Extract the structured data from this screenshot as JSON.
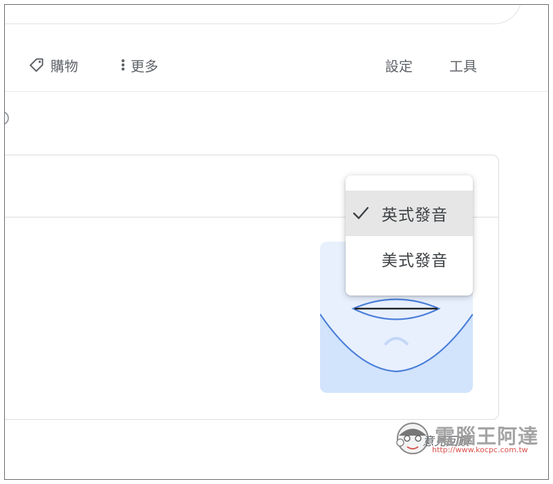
{
  "toolbar": {
    "shopping_label": "購物",
    "more_label": "更多",
    "settings_label": "設定",
    "tools_label": "工具"
  },
  "pronunciation_menu": {
    "items": [
      {
        "label": "英式發音",
        "selected": true
      },
      {
        "label": "美式發音",
        "selected": false
      }
    ]
  },
  "card": {
    "caption": "意見回饋"
  },
  "watermark": {
    "title": "電腦王阿達",
    "url": "http://www.kocpc.com.tw"
  },
  "colors": {
    "accent_blue": "#4a7fd9",
    "illustration_light": "#e8f0fe",
    "illustration_chin": "#d2e3fc",
    "menu_selected": "#e6e6e6",
    "watermark_red": "#d9534f"
  },
  "icons": {
    "shopping": "tag-icon",
    "more": "vertical-dots-icon",
    "check": "checkmark-icon"
  }
}
